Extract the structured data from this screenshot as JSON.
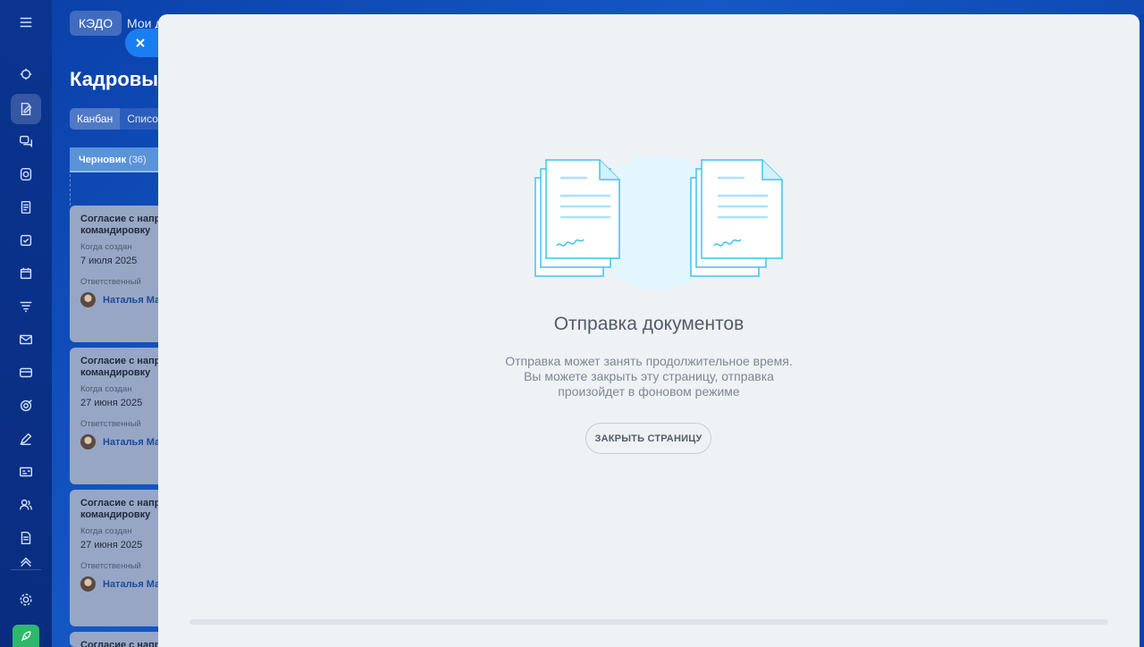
{
  "window": {
    "rail_bg": "#0a3a9a",
    "slider_bg": "#eff2f5",
    "close_tab_color": "#1a7df0",
    "rocket_color": "#2fb86b"
  },
  "rail": {
    "icons": [
      "menu-icon",
      "copilot-icon",
      "sign-document-icon",
      "chat-icon",
      "camera-icon",
      "notes-icon",
      "tasks-icon",
      "calendar-icon",
      "funnel-icon",
      "mail-icon",
      "card-icon",
      "target-icon",
      "pen-icon",
      "id-card-icon",
      "users-icon",
      "document-icon",
      "more-icon",
      "settings-icon",
      "rocket-icon"
    ]
  },
  "background_page": {
    "breadcrumb_pill": "КЭДО",
    "breadcrumb_next": "Мои д",
    "heading": "Кадровые",
    "view_tabs": [
      "Канбан",
      "Списо"
    ],
    "stage": {
      "name": "Черновик",
      "count": "(36)"
    },
    "cards": [
      {
        "title_line1": "Согласие с напр",
        "title_line2": "командировку",
        "created_label": "Когда создан",
        "created_date": "7 июля 2025",
        "responsible_label": "Ответственный",
        "responsible_name": "Наталья Ма"
      },
      {
        "title_line1": "Согласие с напр",
        "title_line2": "командировку",
        "created_label": "Когда создан",
        "created_date": "27 июня 2025",
        "responsible_label": "Ответственный",
        "responsible_name": "Наталья Ма"
      },
      {
        "title_line1": "Согласие с напр",
        "title_line2": "командировку",
        "created_label": "Когда создан",
        "created_date": "27 июня 2025",
        "responsible_label": "Ответственный",
        "responsible_name": "Наталья Ма"
      },
      {
        "title_line1": "Согласие с напр",
        "title_line2": "",
        "created_label": "",
        "created_date": "",
        "responsible_label": "",
        "responsible_name": ""
      }
    ]
  },
  "slider": {
    "title": "Отправка документов",
    "text_line1": "Отправка может занять продолжительное время.",
    "text_line2": "Вы можете закрыть эту страницу, отправка",
    "text_line3": "произойдет в фоновом режиме",
    "close_button": "ЗАКРЫТЬ СТРАНИЦУ",
    "progress": 0
  }
}
